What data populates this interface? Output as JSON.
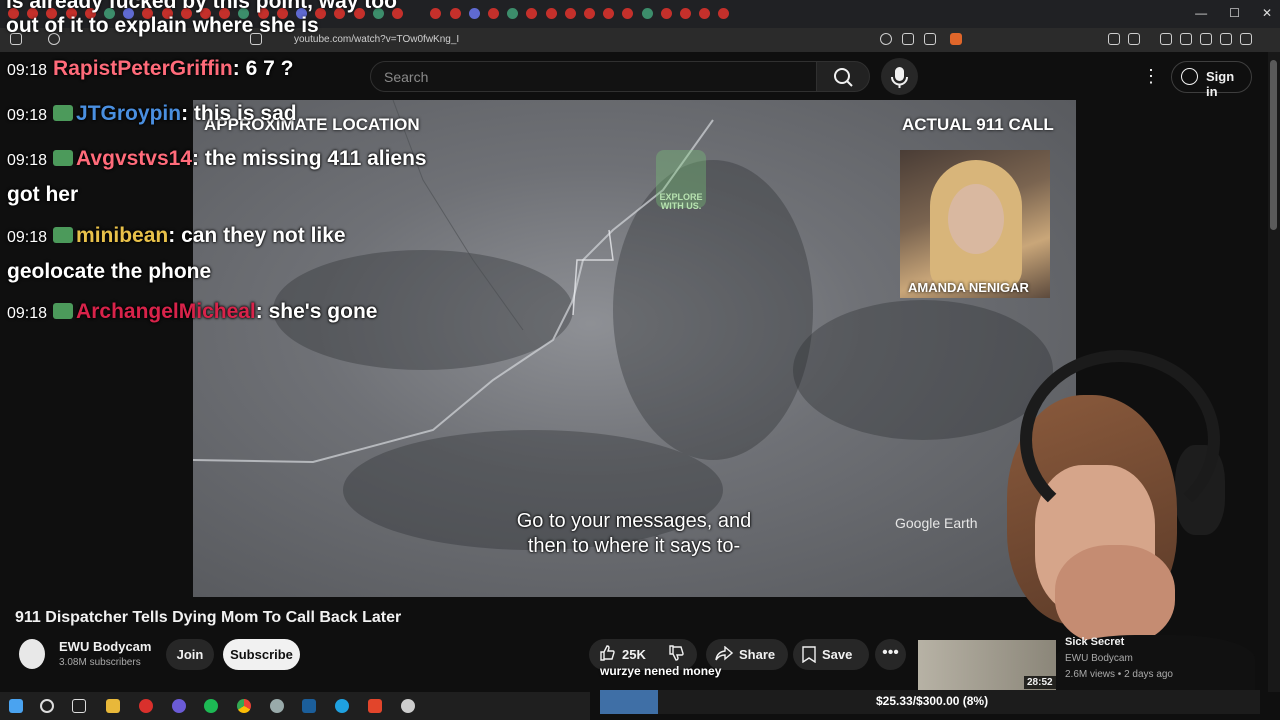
{
  "browser": {
    "url": "youtube.com/watch?v=TOw0fwKng_I"
  },
  "header": {
    "search_placeholder": "Search",
    "signin_label": "Sign in"
  },
  "overlay_top_text": "is already fucked by this point, way too out of it to explain where she is",
  "chat": [
    {
      "time": "09:18",
      "user": "RapistPeterGriffin",
      "user_color": "#ff6b7a",
      "message": "6 7 ?"
    },
    {
      "time": "09:18",
      "user": "JTGroypin",
      "user_color": "#4a8fe0",
      "message": "this is sad"
    },
    {
      "time": "09:18",
      "user": "Avgvstvs14",
      "user_color": "#ff6b7a",
      "message": "the missing 411 aliens got her"
    },
    {
      "time": "09:18",
      "user": "minibean",
      "user_color": "#e8c14a",
      "message": "can they not like geolocate the phone"
    },
    {
      "time": "09:18",
      "user": "ArchangelMicheal",
      "user_color": "#d8234a",
      "message": "she's gone"
    }
  ],
  "video": {
    "label_left": "APPROXIMATE LOCATION",
    "label_right": "ACTUAL 911 CALL",
    "photo_name": "AMANDA NENIGAR",
    "logo_text": "EXPLORE WITH US.",
    "watermark": "Google Earth",
    "subtitle_line1": "Go to your messages, and",
    "subtitle_line2": "then to where it says to-"
  },
  "video_info": {
    "title": "911 Dispatcher Tells Dying Mom To Call Back Later",
    "channel": "EWU Bodycam",
    "subscribers": "3.08M subscribers",
    "join_label": "Join",
    "subscribe_label": "Subscribe",
    "likes": "25K",
    "share_label": "Share",
    "save_label": "Save",
    "more_label": "•••"
  },
  "recommendation": {
    "title": "Sick Secret",
    "channel": "EWU Bodycam",
    "meta": "2.6M views • 2 days ago",
    "duration": "28:52"
  },
  "donation": {
    "donor_text": "wurzye nened money",
    "goal_text": "$25.33/$300.00 (8%)",
    "goal_fraction": 0.08
  },
  "window_controls": {
    "minimize": "—",
    "maximize": "☐",
    "close": "✕"
  }
}
